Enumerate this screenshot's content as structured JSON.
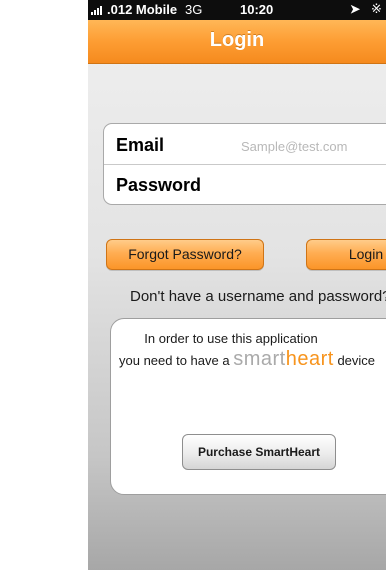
{
  "status_bar": {
    "carrier": ".012 Mobile",
    "network": "3G",
    "time": "10:20",
    "location_icon": "location-arrow-icon",
    "bluetooth_icon": "bluetooth-icon"
  },
  "nav": {
    "title": "Login"
  },
  "form": {
    "email_label": "Email",
    "email_placeholder": "Sample@test.com",
    "email_value": "",
    "password_label": "Password",
    "password_value": ""
  },
  "buttons": {
    "forgot_password": "Forgot Password?",
    "login": "Login"
  },
  "signup": {
    "prompt": "Don't have a username and password?",
    "info_line1": "In order to use this application",
    "info_line2_prefix": "you need to have a",
    "brand_smart": "smart",
    "brand_heart": "heart",
    "info_line2_suffix": "device",
    "purchase_button": "Purchase SmartHeart"
  },
  "colors": {
    "accent": "#fd9d33",
    "brand_orange": "#f7941d",
    "brand_gray": "#aaaaaa"
  }
}
